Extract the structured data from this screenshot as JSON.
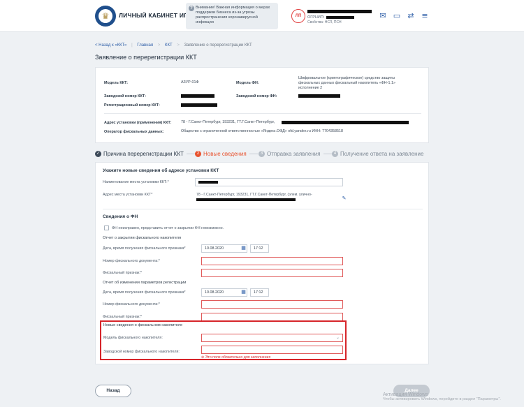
{
  "header": {
    "brand": "ЛИЧНЫЙ КАБИНЕТ ИП",
    "notice_icon": "?",
    "notice": "Внимание! Важная информация о мерах поддержки бизнеса из-за угрозы распространения коронавирусной инфекции",
    "avatar_initials": "ЛП",
    "user_prefix": "ОГРНИП:",
    "user_status": "Свойства: НСЛ, ПСН",
    "icons": [
      "mail-icon",
      "chat-icon",
      "swap-icon",
      "menu-icon"
    ]
  },
  "breadcrumb": {
    "back": "< Назад к «ККТ»",
    "home": "Главная",
    "kkt": "ККТ",
    "current": "Заявление о перерегистрации ККТ",
    "separator": ">"
  },
  "page_title": "Заявление о перерегистрации ККТ",
  "info": {
    "model_kkt_label": "Модель ККТ:",
    "model_kkt_value": "АЗУР-01Ф",
    "model_fn_label": "Модель ФН:",
    "model_fn_value": "Шифровальное (криптографическое) средство защиты фискальных данных фискальный накопитель «ФН-1.1» исполнение 2",
    "serial_kkt_label": "Заводской номер ККТ:",
    "serial_fn_label": "Заводской номер ФН:",
    "reg_number_label": "Регистрационный номер ККТ:",
    "address_label": "Адрес установки (применения) ККТ:",
    "address_value": "78 - Г.Санкт-Петербург, 193231, ГТ.Г.Санкт-Петербург,",
    "ofd_label": "Оператор фискальных данных:",
    "ofd_value": "Общество с ограниченной ответственностью «Яндекс.ОФД» ofd.yandex.ru ИНН: 7704358518"
  },
  "steps": [
    {
      "num": "✓",
      "label": "Причина перерегистрации ККТ",
      "state": "done"
    },
    {
      "num": "2",
      "label": "Новые сведения",
      "state": "active"
    },
    {
      "num": "3",
      "label": "Отправка заявления",
      "state": "pending"
    },
    {
      "num": "4",
      "label": "Получение ответа на заявление",
      "state": "pending"
    }
  ],
  "form": {
    "address_section_title": "Укажите новые сведения об адресе установки ККТ",
    "place_name_label": "Наименование места установки ККТ:*",
    "address_label": "Адрес места установки ККТ*",
    "address_value": "78 - Г.Санкт-Петербург, 193231, ГТ.Г.Санкт-Петербург, (элем. улично-",
    "fn_section_title": "Сведения о ФН",
    "fn_broken_label": "ФН неисправен, представить отчет о закрытии ФН невозможно.",
    "closing_report_title": "Отчет о закрытии фискального накопителя",
    "change_report_title": "Отчет об изменении параметров регистрации",
    "datetime_label": "Дата, время получения фискального признака*",
    "date_value": "10.08.2020",
    "time_value": "17:12",
    "doc_number_label": "Номер фискального документа:*",
    "fiscal_sign_label": "Фискальный признак:*",
    "new_fn_title": "Новые сведения о фискальном накопителе",
    "fn_model_label": "Модель фискального накопителя:",
    "fn_serial_label": "Заводской номер фискального накопителя:",
    "required_error": "Это поле обязательно для заполнения"
  },
  "buttons": {
    "back": "Назад",
    "next": "Далее"
  },
  "watermark": {
    "line1": "Активация Windows",
    "line2": "Чтобы активировать Windows, перейдите в раздел \"Параметры\"."
  },
  "colors": {
    "accent": "#2f5fa8",
    "active_step": "#e8532f",
    "error": "#d6252a",
    "done_step": "#3d4a59"
  }
}
